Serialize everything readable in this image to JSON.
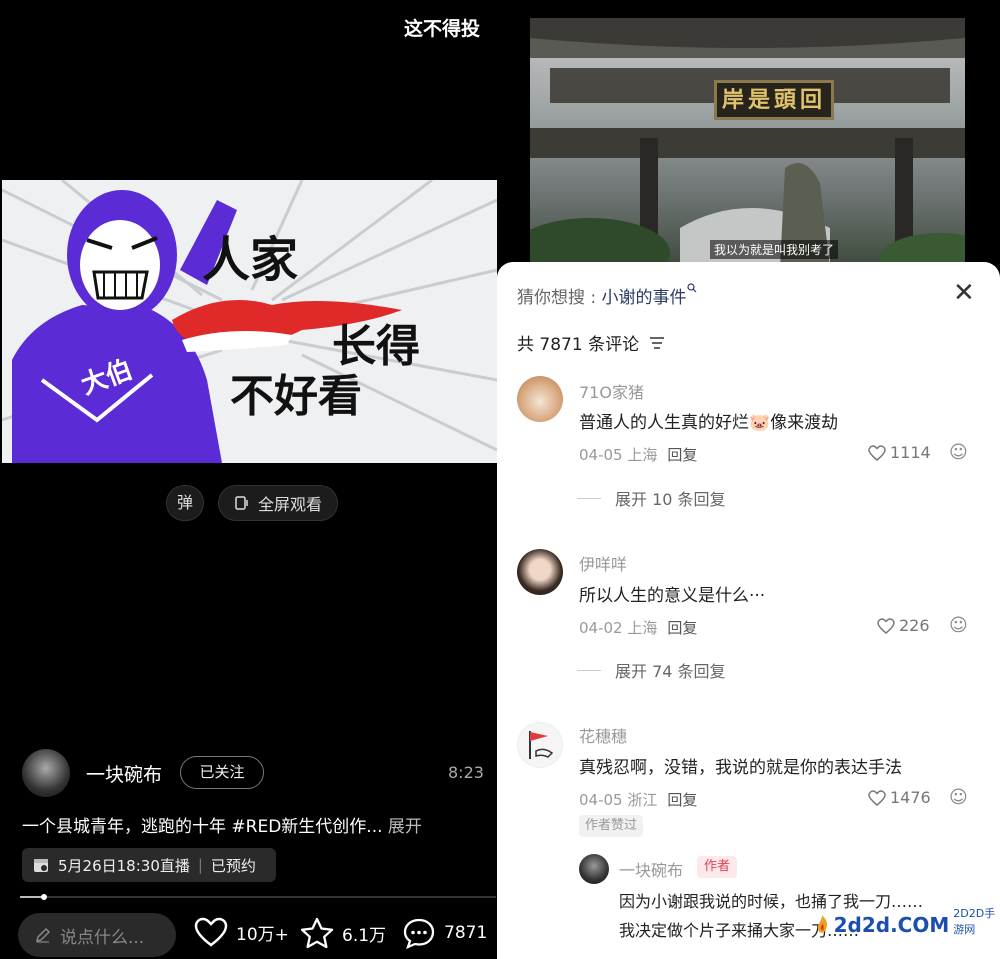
{
  "left": {
    "top_title": "这不得投",
    "meme": {
      "line1": "人家",
      "line2": "长得",
      "line3": "不好看",
      "chest_text": "大伯"
    },
    "danmu_label": "弹",
    "fullscreen_label": "全屏观看",
    "author": {
      "name": "一块碗布",
      "follow_label": "已关注",
      "duration": "8:23"
    },
    "description": "一个县城青年，逃跑的十年 #RED新生代创作...",
    "description_more": "展开",
    "live": {
      "label": "5月26日18:30直播",
      "status": "已预约"
    },
    "progress": 0.05,
    "input_placeholder": "说点什么...",
    "likes": "10万+",
    "favorites": "6.1万",
    "comments": "7871"
  },
  "right": {
    "gate_sign": "岸是頭回",
    "subtitle": "我以为就是叫我别考了",
    "guess_prefix": "猜你想搜 : ",
    "guess_keyword": "小谢的事件",
    "comment_count": "共 7871 条评论",
    "comments": [
      {
        "name": "71O家猪",
        "text": "普通人的人生真的好烂🐷像来渡劫",
        "date_loc": "04-05 上海",
        "reply_label": "回复",
        "likes": "1114",
        "expand": "展开 10 条回复"
      },
      {
        "name": "伊咩咩",
        "text": "所以人生的意义是什么···",
        "date_loc": "04-02 上海",
        "reply_label": "回复",
        "likes": "226",
        "expand": "展开 74 条回复"
      },
      {
        "name": "花穗穗",
        "text": "真残忍啊，没错，我说的就是你的表达手法",
        "date_loc": "04-05 浙江",
        "reply_label": "回复",
        "likes": "1476",
        "badge": "作者赞过"
      }
    ],
    "sub_reply": {
      "name": "一块碗布",
      "tag": "作者",
      "line1": "因为小谢跟我说的时候，也捅了我一刀……",
      "line2": "我决定做个片子来捅大家一刀……"
    },
    "watermark": {
      "logo": "2d2d.COM",
      "small": "2D2D手游网"
    }
  }
}
